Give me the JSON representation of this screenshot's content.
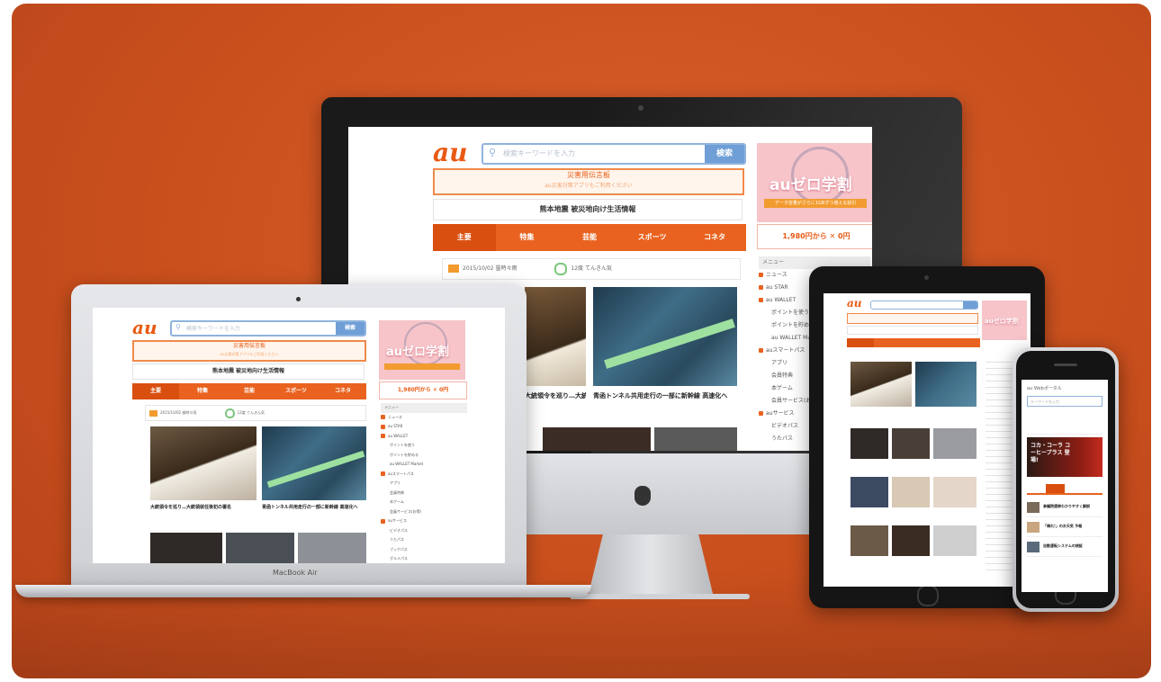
{
  "brand": {
    "logo": "au"
  },
  "search": {
    "placeholder": "検索キーワードを入力",
    "go": "検索"
  },
  "banner": {
    "title": "災害用伝言板",
    "sub": "au災害対策アプリもご利用ください"
  },
  "local": {
    "title": "熊本地震 被災地向け生活情報"
  },
  "tabs": [
    "主要",
    "特集",
    "芸能",
    "スポーツ",
    "コネタ"
  ],
  "weather": {
    "item1": "2015/10/02 曇時々雨",
    "item2": "12度 てんきん気"
  },
  "ad": {
    "title": "auゼロ学割",
    "bar": "データ容量がさらに1GBずつ増える割引",
    "foot": "1,980円から ✕ 0円"
  },
  "menu": {
    "head": "メニュー",
    "items": [
      "ニュース",
      "au STAR",
      "au WALLET",
      "ポイントを使う",
      "ポイントを貯める",
      "au WALLET Market",
      "auスマートパス",
      "アプリ",
      "会員特典",
      "本ゲーム",
      "会員サービス(お得)",
      "auサービス",
      "ビデオパス",
      "うたパス",
      "ブックパス",
      "グルメパス"
    ]
  },
  "news": [
    {
      "caption": "大統領令を巡り…大統領就任後初の署名"
    },
    {
      "caption": "青函トンネル共用走行の一部に新幹線 高速化へ"
    }
  ],
  "laptop": {
    "label": "MacBook Air"
  },
  "phone": {
    "site": "au Webポータル",
    "search": "キーワードを入力",
    "ad": "コカ・コーラ コーヒープラス 登場!",
    "list": [
      "参議院選挙わかりやすく解説",
      "「晴れ!」のお天気 予報",
      "自動運転システムの検証"
    ]
  }
}
